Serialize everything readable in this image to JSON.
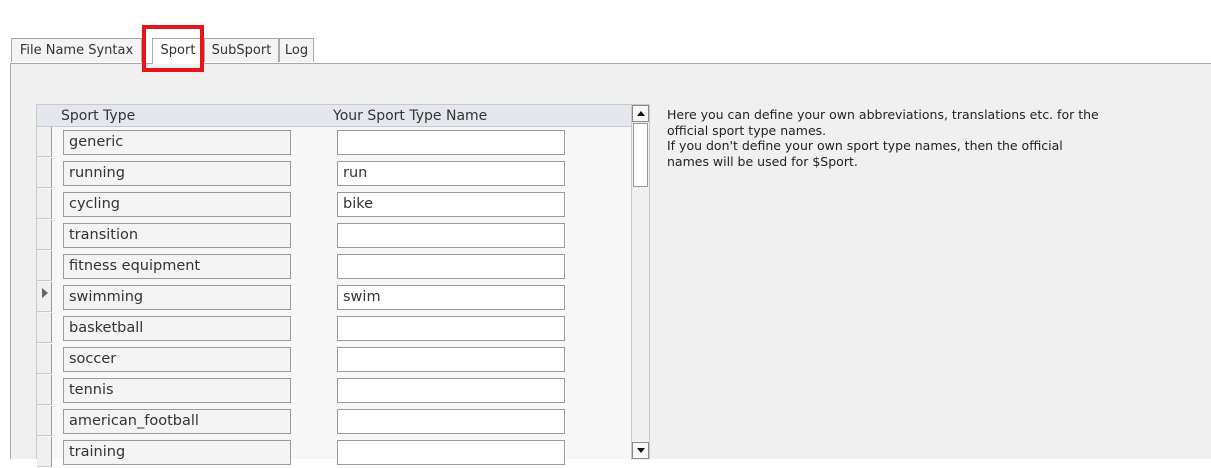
{
  "tabs": [
    {
      "label": "File Name Syntax",
      "active": false
    },
    {
      "label": "Sport",
      "active": true
    },
    {
      "label": "SubSport",
      "active": false
    },
    {
      "label": "Log",
      "active": false
    }
  ],
  "grid": {
    "headers": {
      "sport_type": "Sport Type",
      "your_name": "Your Sport Type Name"
    },
    "rows": [
      {
        "type": "generic",
        "name": ""
      },
      {
        "type": "running",
        "name": "run"
      },
      {
        "type": "cycling",
        "name": "bike"
      },
      {
        "type": "transition",
        "name": ""
      },
      {
        "type": "fitness equipment",
        "name": ""
      },
      {
        "type": "swimming",
        "name": "swim",
        "current": true
      },
      {
        "type": "basketball",
        "name": ""
      },
      {
        "type": "soccer",
        "name": ""
      },
      {
        "type": "tennis",
        "name": ""
      },
      {
        "type": "american_football",
        "name": ""
      },
      {
        "type": "training",
        "name": ""
      }
    ]
  },
  "help": {
    "lines": [
      "Here you can define your own abbreviations, translations etc. for the",
      "official sport type names.",
      "If you don't define your own sport type names, then the official",
      "names will be used for $Sport."
    ]
  },
  "colors": {
    "highlight": "#e8141c",
    "header_bg": "#e4e7ee",
    "panel_bg": "#f0f0f0"
  }
}
